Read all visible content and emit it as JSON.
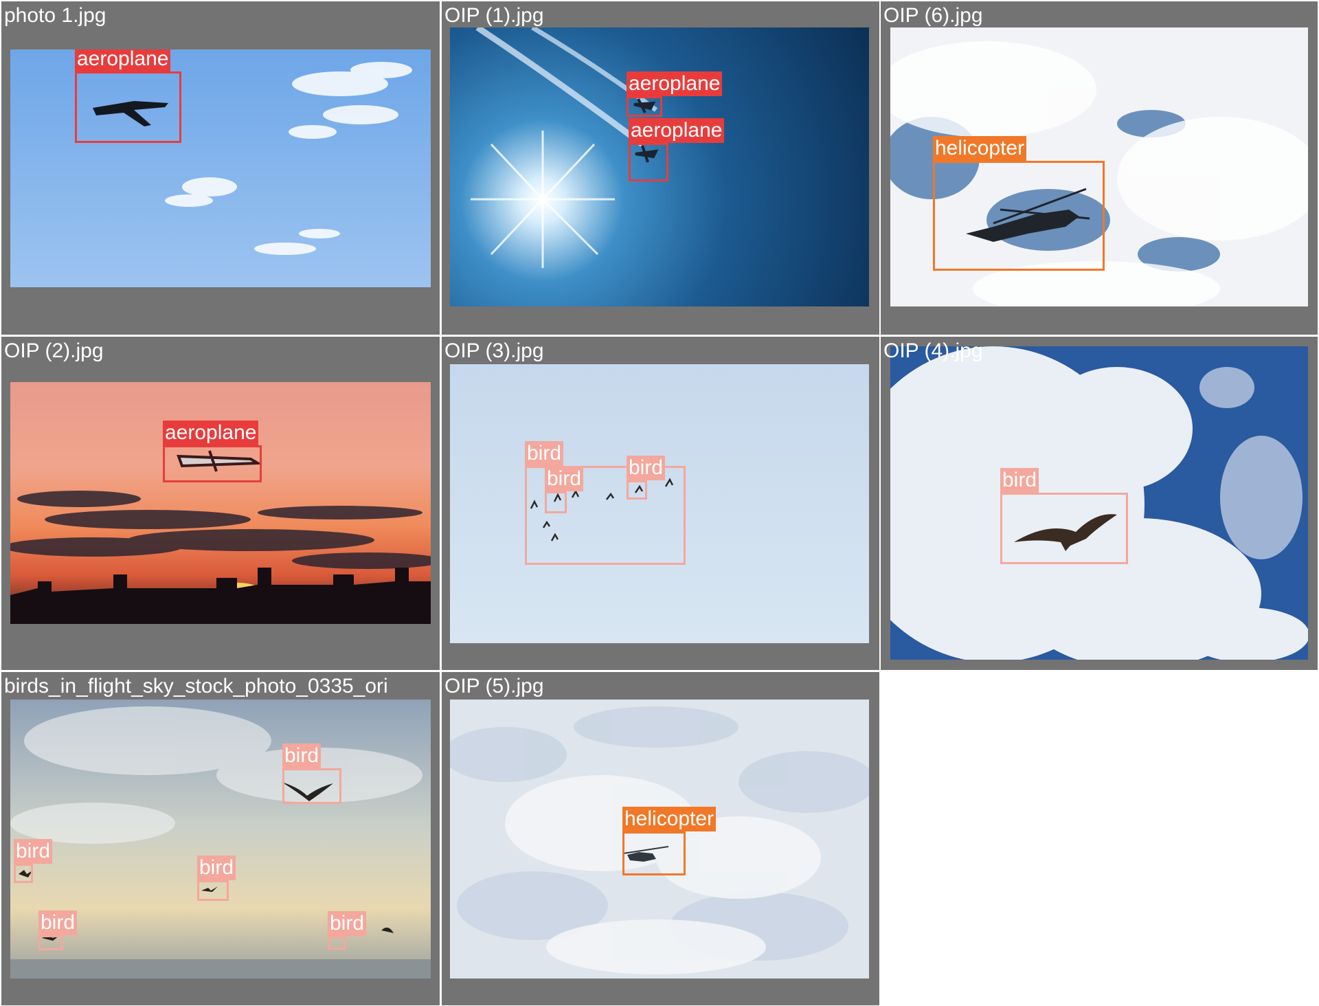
{
  "grid": {
    "cells": [
      {
        "title": "photo 1.jpg",
        "detections": [
          {
            "label": "aeroplane"
          }
        ]
      },
      {
        "title": "OIP (1).jpg",
        "detections": [
          {
            "label": "aeroplane"
          },
          {
            "label": "aeroplane"
          }
        ]
      },
      {
        "title": "OIP (6).jpg",
        "detections": [
          {
            "label": "helicopter"
          }
        ]
      },
      {
        "title": "OIP (2).jpg",
        "detections": [
          {
            "label": "aeroplane"
          }
        ]
      },
      {
        "title": "OIP (3).jpg",
        "detections": [
          {
            "label": "bird"
          },
          {
            "label": "bird"
          },
          {
            "label": "bird"
          }
        ]
      },
      {
        "title": "OIP (4).jpg",
        "detections": [
          {
            "label": "bird"
          }
        ]
      },
      {
        "title": "birds_in_flight_sky_stock_photo_0335_ori",
        "detections": [
          {
            "label": "bird"
          },
          {
            "label": "bird"
          },
          {
            "label": "bird"
          },
          {
            "label": "bird"
          },
          {
            "label": "bird"
          }
        ]
      },
      {
        "title": "OIP (5).jpg",
        "detections": [
          {
            "label": "helicopter"
          }
        ]
      }
    ]
  },
  "colors": {
    "aeroplane": "#e83c3c",
    "helicopter": "#f07828",
    "bird": "#f4a79c",
    "cell_background": "#737373"
  }
}
